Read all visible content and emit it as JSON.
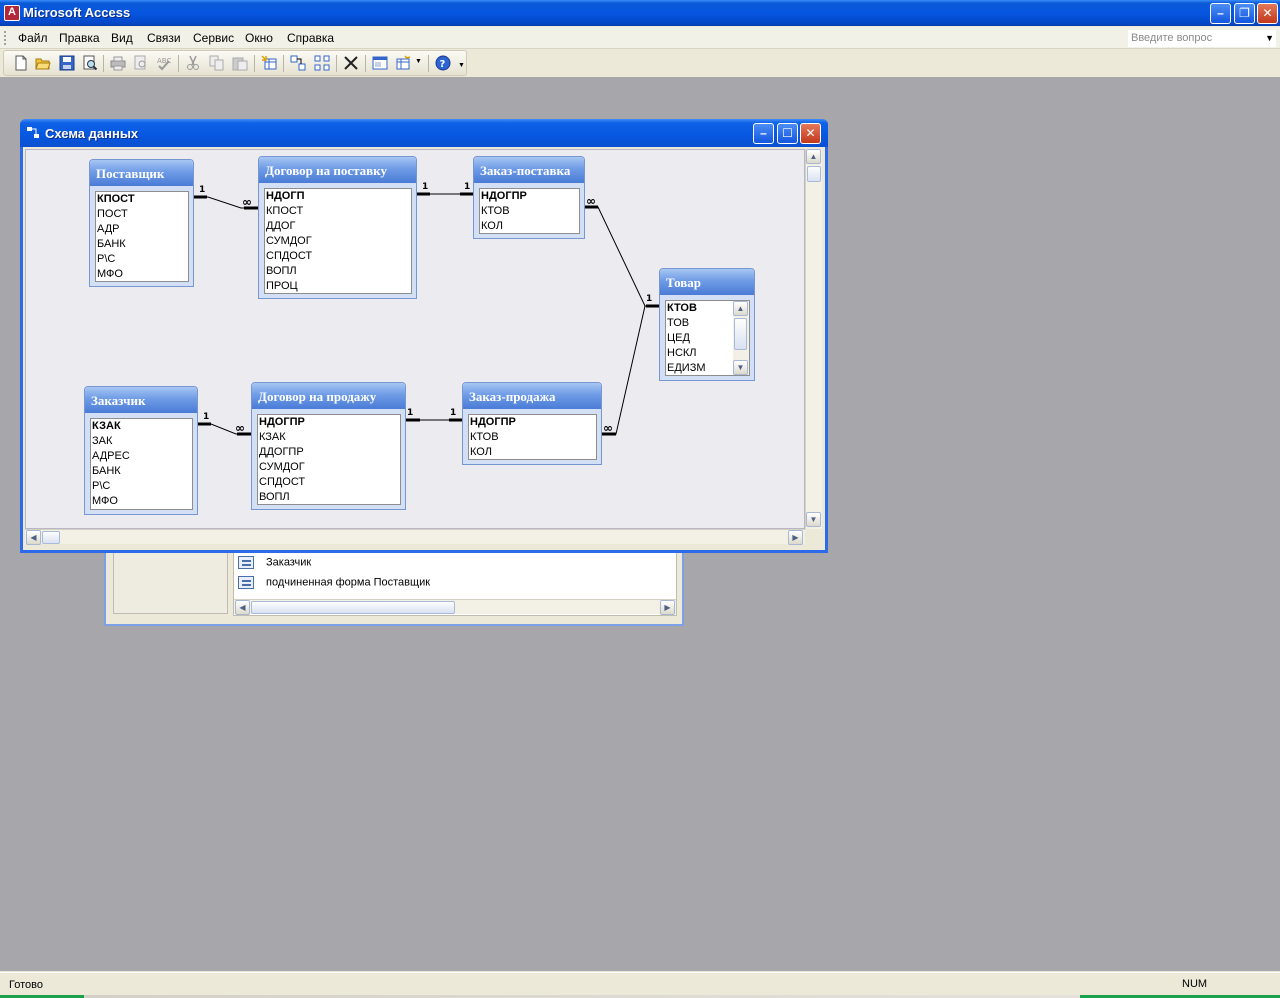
{
  "window": {
    "title": "Microsoft Access"
  },
  "menu": [
    "Файл",
    "Правка",
    "Вид",
    "Связи",
    "Сервис",
    "Окно",
    "Справка"
  ],
  "ask": {
    "placeholder": "Введите вопрос"
  },
  "toolbar_icons": [
    "new-icon",
    "open-icon",
    "save-icon",
    "search-icon",
    "print-icon",
    "print-preview-icon",
    "spelling-icon",
    "cut-icon",
    "copy-icon",
    "paste-icon",
    "show-table-icon",
    "show-direct-icon",
    "show-all-icon",
    "delete-icon",
    "database-window-icon",
    "new-object-icon",
    "help-icon"
  ],
  "db_window": {
    "items": [
      "Заказчик",
      "подчиненная форма Поставщик"
    ]
  },
  "schema": {
    "title": "Схема данных",
    "tables": [
      {
        "name": "Поставщик",
        "fields": [
          "КПОСТ",
          "ПОСТ",
          "АДР",
          "БАНК",
          "Р\\С",
          "МФО"
        ]
      },
      {
        "name": "Договор на поставку",
        "fields": [
          "НДОГП",
          "КПОСТ",
          "ДДОГ",
          "СУМДОГ",
          "СПДОСТ",
          "ВОПЛ",
          "ПРОЦ"
        ]
      },
      {
        "name": "Заказ-поставка",
        "fields": [
          "НДОГПР",
          "КТОВ",
          "КОЛ"
        ]
      },
      {
        "name": "Товар",
        "fields": [
          "КТОВ",
          "ТОВ",
          "ЦЕД",
          "НСКЛ",
          "ЕДИЗМ"
        ]
      },
      {
        "name": "Заказчик",
        "fields": [
          "КЗАК",
          "ЗАК",
          "АДРЕС",
          "БАНК",
          "Р\\С",
          "МФО"
        ]
      },
      {
        "name": "Договор на продажу",
        "fields": [
          "НДОГПР",
          "КЗАК",
          "ДДОГПР",
          "СУМДОГ",
          "СПДОСТ",
          "ВОПЛ"
        ]
      },
      {
        "name": "Заказ-продажа",
        "fields": [
          "НДОГПР",
          "КТОВ",
          "КОЛ"
        ]
      }
    ],
    "rel_labels": {
      "one": "1",
      "many": "∞"
    }
  },
  "status": {
    "text": "Готово",
    "num": "NUM"
  }
}
